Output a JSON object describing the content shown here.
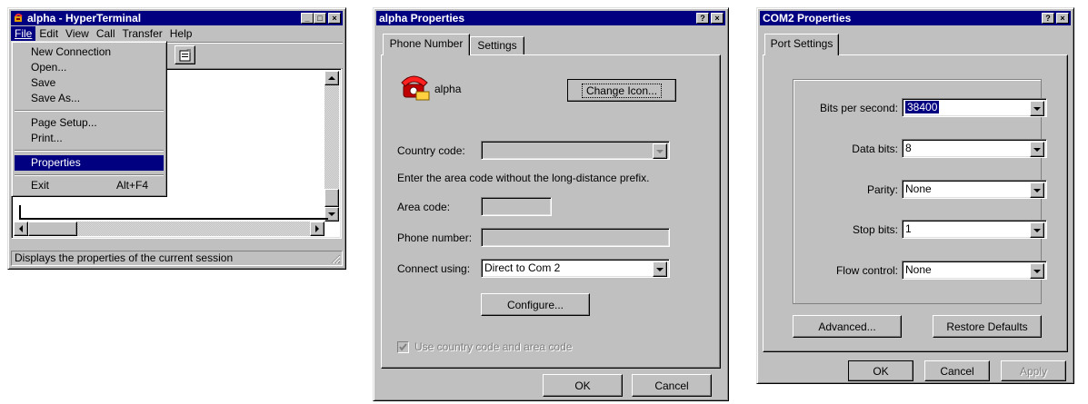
{
  "hyperterminal": {
    "title": "alpha - HyperTerminal",
    "menubar": [
      "File",
      "Edit",
      "View",
      "Call",
      "Transfer",
      "Help"
    ],
    "file_menu": {
      "items": [
        {
          "label": "New Connection",
          "shortcut": ""
        },
        {
          "label": "Open...",
          "shortcut": ""
        },
        {
          "label": "Save",
          "shortcut": ""
        },
        {
          "label": "Save As...",
          "shortcut": ""
        },
        {
          "label": "Page Setup...",
          "shortcut": ""
        },
        {
          "label": "Print...",
          "shortcut": ""
        },
        {
          "label": "Properties",
          "shortcut": "",
          "highlighted": true
        },
        {
          "label": "Exit",
          "shortcut": "Alt+F4"
        }
      ]
    },
    "toolbar_icon": "properties-icon",
    "status_text": "Displays the properties of the current session"
  },
  "alpha_properties": {
    "title": "alpha Properties",
    "tabs": [
      "Phone Number",
      "Settings"
    ],
    "active_tab": "Phone Number",
    "connection_name": "alpha",
    "connection_icon": "red-telephone-icon",
    "change_icon_label": "Change Icon...",
    "country_code_label": "Country code:",
    "country_code_value": "",
    "area_hint": "Enter the area code without the long-distance prefix.",
    "area_code_label": "Area code:",
    "area_code_value": "",
    "phone_number_label": "Phone number:",
    "phone_number_value": "",
    "connect_using_label": "Connect using:",
    "connect_using_value": "Direct to Com 2",
    "configure_label": "Configure...",
    "use_country_code_label": "Use country code and area code",
    "use_country_code_checked": true,
    "ok_label": "OK",
    "cancel_label": "Cancel"
  },
  "com2_properties": {
    "title": "COM2 Properties",
    "tab": "Port Settings",
    "bits_per_second_label": "Bits per second:",
    "bits_per_second_value": "38400",
    "data_bits_label": "Data bits:",
    "data_bits_value": "8",
    "parity_label": "Parity:",
    "parity_value": "None",
    "stop_bits_label": "Stop bits:",
    "stop_bits_value": "1",
    "flow_control_label": "Flow control:",
    "flow_control_value": "None",
    "advanced_label": "Advanced...",
    "restore_defaults_label": "Restore Defaults",
    "ok_label": "OK",
    "cancel_label": "Cancel",
    "apply_label": "Apply"
  },
  "colors": {
    "title_bar": "#000080",
    "dialog_face": "#c0c0c0",
    "highlight": "#000080"
  }
}
